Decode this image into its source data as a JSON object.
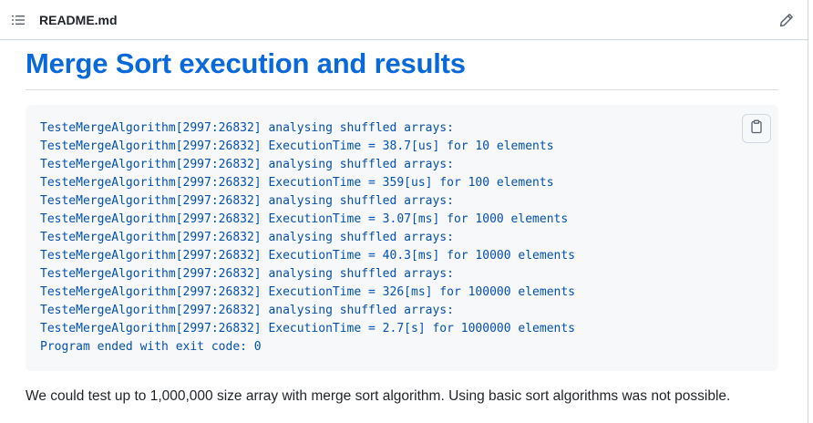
{
  "header": {
    "list_icon": "list-unordered-icon",
    "file_name": "README.md",
    "edit_icon": "pencil-icon"
  },
  "readme": {
    "title": "Merge Sort execution and results",
    "code_lines": [
      "TesteMergeAlgorithm[2997:26832] analysing shuffled arrays:",
      "TesteMergeAlgorithm[2997:26832] ExecutionTime = 38.7[us] for 10 elements",
      "TesteMergeAlgorithm[2997:26832] analysing shuffled arrays:",
      "TesteMergeAlgorithm[2997:26832] ExecutionTime = 359[us] for 100 elements",
      "TesteMergeAlgorithm[2997:26832] analysing shuffled arrays:",
      "TesteMergeAlgorithm[2997:26832] ExecutionTime = 3.07[ms] for 1000 elements",
      "TesteMergeAlgorithm[2997:26832] analysing shuffled arrays:",
      "TesteMergeAlgorithm[2997:26832] ExecutionTime = 40.3[ms] for 10000 elements",
      "TesteMergeAlgorithm[2997:26832] analysing shuffled arrays:",
      "TesteMergeAlgorithm[2997:26832] ExecutionTime = 326[ms] for 100000 elements",
      "TesteMergeAlgorithm[2997:26832] analysing shuffled arrays:",
      "TesteMergeAlgorithm[2997:26832] ExecutionTime = 2.7[s] for 1000000 elements",
      "Program ended with exit code: 0"
    ],
    "copy_icon": "copy-clipboard-icon",
    "paragraph": "We could test up to 1,000,000 size array with merge sort algorithm. Using basic sort algorithms was not possible."
  },
  "colors": {
    "title": "#0969da",
    "code_text": "#0550ae",
    "code_bg": "#f6f8fa",
    "border": "#d0d7de",
    "text": "#1f2328"
  }
}
